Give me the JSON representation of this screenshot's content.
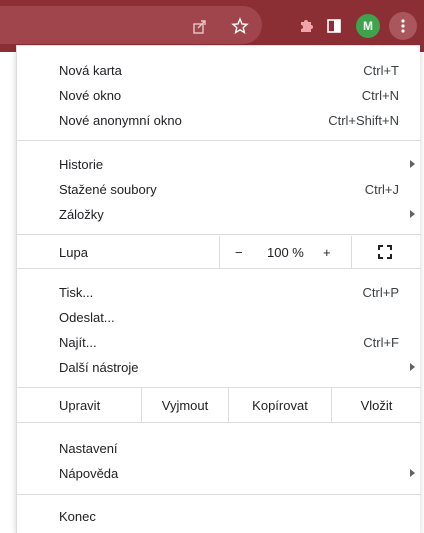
{
  "toolbar": {
    "share_icon": "share-icon",
    "star_icon": "star-icon",
    "extensions_icon": "puzzle-icon",
    "sidepanel_icon": "side-panel-icon",
    "avatar_letter": "M",
    "menu_icon": "three-dots-icon",
    "colors": {
      "background": "#8c2f35",
      "omnibox": "#a0454b",
      "avatar": "#3fa34d"
    }
  },
  "menu": {
    "group1": [
      {
        "label": "Nová karta",
        "shortcut": "Ctrl+T"
      },
      {
        "label": "Nové okno",
        "shortcut": "Ctrl+N"
      },
      {
        "label": "Nové anonymní okno",
        "shortcut": "Ctrl+Shift+N"
      }
    ],
    "group2": [
      {
        "label": "Historie"
      },
      {
        "label": "Stažené soubory",
        "shortcut": "Ctrl+J"
      },
      {
        "label": "Záložky"
      }
    ],
    "zoom": {
      "label": "Lupa",
      "minus": "−",
      "value": "100 %",
      "plus": "+"
    },
    "group3": [
      {
        "label": "Tisk...",
        "shortcut": "Ctrl+P"
      },
      {
        "label": "Odeslat..."
      },
      {
        "label": "Najít...",
        "shortcut": "Ctrl+F"
      },
      {
        "label": "Další nástroje"
      }
    ],
    "edit": {
      "label": "Upravit",
      "cut": "Vyjmout",
      "copy": "Kopírovat",
      "paste": "Vložit"
    },
    "group4": [
      {
        "label": "Nastavení"
      },
      {
        "label": "Nápověda"
      }
    ],
    "exit": {
      "label": "Konec"
    }
  }
}
